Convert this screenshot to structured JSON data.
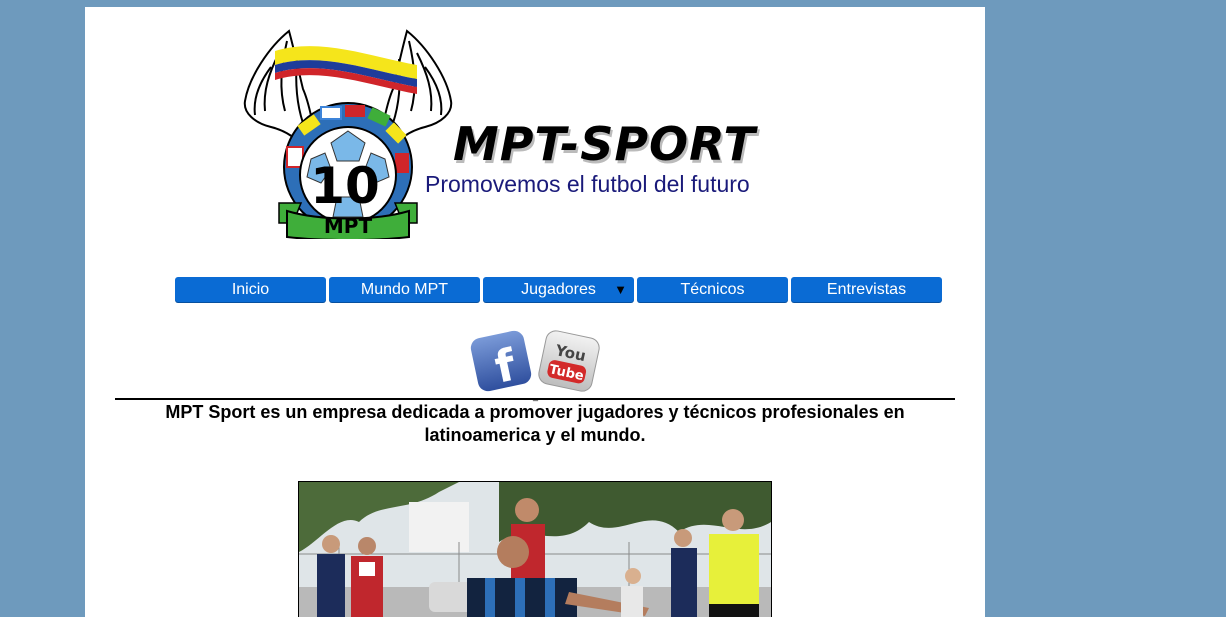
{
  "brand": {
    "name": "MPT-SPORT",
    "tagline": "Promovemos el futbol del futuro",
    "badge_number": "10",
    "badge_label": "MPT"
  },
  "nav": {
    "items": [
      {
        "label": "Inicio"
      },
      {
        "label": "Mundo MPT"
      },
      {
        "label": "Jugadores",
        "caret": "▼"
      },
      {
        "label": "Técnicos"
      },
      {
        "label": "Entrevistas"
      }
    ]
  },
  "social": {
    "facebook_glyph": "f",
    "youtube_top": "You",
    "youtube_bottom": "Tube",
    "link_text": "_"
  },
  "intro": {
    "text": "MPT Sport es un empresa dedicada a promover jugadores y técnicos profesionales en latinoamerica y el mundo."
  },
  "colors": {
    "background": "#6e9abd",
    "nav_button": "#0a6bd4",
    "tagline": "#1a1a7a",
    "flag_yellow": "#f5e51b",
    "flag_blue": "#1e3c9a",
    "flag_red": "#d0252a",
    "ribbon_green": "#3fae3a"
  }
}
